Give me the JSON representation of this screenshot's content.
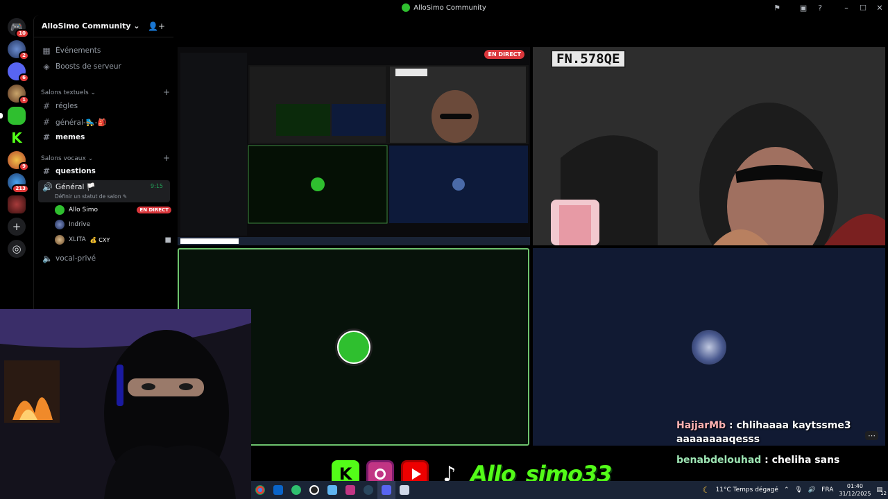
{
  "window": {
    "title": "AlloSimo Community"
  },
  "rail": {
    "badges": [
      "10",
      "2",
      "6",
      "1",
      "9",
      "213"
    ]
  },
  "server": {
    "name": "AlloSimo Community"
  },
  "sidebar": {
    "events_label": "Événements",
    "boosts_label": "Boosts de serveur",
    "text_category": "Salons textuels",
    "text_channels": [
      "régles",
      "général-🛼-🎒",
      "memes",
      "questions"
    ],
    "voice_category": "Salons vocaux",
    "voice_channel": {
      "name": "Général",
      "flag": "🏳️",
      "time": "9:15",
      "status_prompt": "Définir un statut de salon"
    },
    "voice_users": [
      {
        "name": "Allo Simo",
        "live": "EN DIRECT"
      },
      {
        "name": "Indrive"
      },
      {
        "name": "XLITA",
        "suffix": "💰 CXY"
      }
    ],
    "private_channel": "vocal-privé"
  },
  "streams": {
    "live_label": "EN DIRECT",
    "plate_text": "FN.578QE"
  },
  "chat": [
    {
      "user": "HajjarMb",
      "user_color": "#ffb3b3",
      "text": "chlihaaaa kaytssme3 aaaaaaaaqesss"
    },
    {
      "user": "benabdelouhad",
      "user_color": "#9ee6b4",
      "text": "cheliha sans"
    }
  ],
  "socials": {
    "handle": "Allo_simo33"
  },
  "taskbar": {
    "weather": "11°C  Temps dégagé",
    "lang": "FRA",
    "time": "01:40",
    "date": "31/12/2025",
    "notif_count": "12"
  },
  "colors": {
    "kick_green": "#53fc18",
    "live_red": "#da373c",
    "discord_blurple": "#5865f2"
  }
}
